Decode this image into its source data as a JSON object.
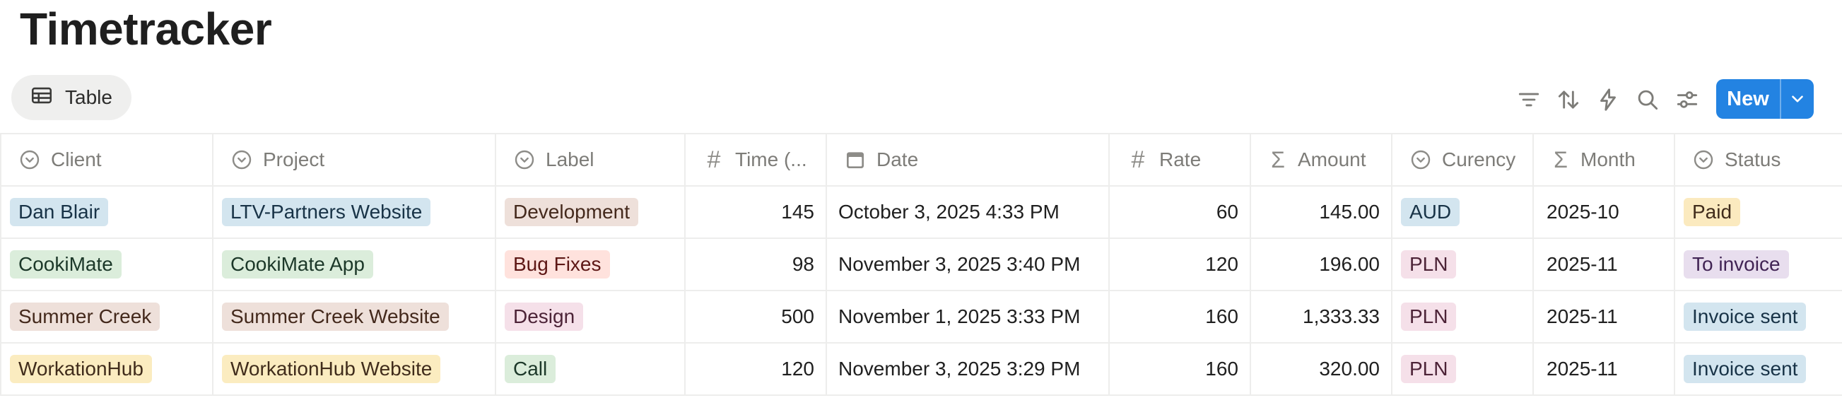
{
  "page": {
    "title": "Timetracker"
  },
  "view": {
    "tab_label": "Table"
  },
  "toolbar": {
    "icons": [
      "filter-icon",
      "sort-icon",
      "automation-icon",
      "search-icon",
      "settings-icon"
    ],
    "new_label": "New"
  },
  "columns": [
    {
      "label": "Client",
      "icon": "select-icon"
    },
    {
      "label": "Project",
      "icon": "select-icon"
    },
    {
      "label": "Label",
      "icon": "select-icon"
    },
    {
      "label": "Time (...",
      "icon": "number-icon"
    },
    {
      "label": "Date",
      "icon": "calendar-icon"
    },
    {
      "label": "Rate",
      "icon": "number-icon"
    },
    {
      "label": "Amount",
      "icon": "formula-icon"
    },
    {
      "label": "Curency",
      "icon": "select-icon"
    },
    {
      "label": "Month",
      "icon": "formula-icon"
    },
    {
      "label": "Status",
      "icon": "select-icon"
    }
  ],
  "rows": [
    {
      "client": "Dan Blair",
      "project": "LTV-Partners Website",
      "label": "Development",
      "time": "145",
      "date": "October 3, 2025 4:33 PM",
      "rate": "60",
      "amount": "145.00",
      "currency": "AUD",
      "month": "2025-10",
      "status": "Paid"
    },
    {
      "client": "CookiMate",
      "project": "CookiMate App",
      "label": "Bug Fixes",
      "time": "98",
      "date": "November 3, 2025 3:40 PM",
      "rate": "120",
      "amount": "196.00",
      "currency": "PLN",
      "month": "2025-11",
      "status": "To invoice"
    },
    {
      "client": "Summer Creek",
      "project": "Summer Creek Website",
      "label": "Design",
      "time": "500",
      "date": "November 1, 2025 3:33 PM",
      "rate": "160",
      "amount": "1,333.33",
      "currency": "PLN",
      "month": "2025-11",
      "status": "Invoice sent"
    },
    {
      "client": "WorkationHub",
      "project": "WorkationHub Website",
      "label": "Call",
      "time": "120",
      "date": "November 3, 2025 3:29 PM",
      "rate": "160",
      "amount": "320.00",
      "currency": "PLN",
      "month": "2025-11",
      "status": "Invoice sent"
    }
  ],
  "colors": {
    "accent": "#2383e2",
    "tag_blue": "#d3e5ef",
    "tag_green": "#dbeddb",
    "tag_brown": "#eee0da",
    "tag_yellow": "#fbecc0",
    "tag_red": "#ffe2dd",
    "tag_pink": "#f5e0e9",
    "tag_purple": "#e8deee"
  }
}
